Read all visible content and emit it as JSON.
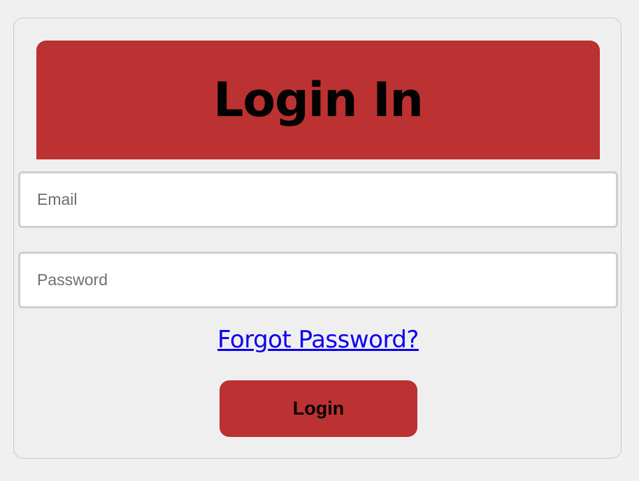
{
  "header": {
    "title": "Login In"
  },
  "form": {
    "email_placeholder": "Email",
    "email_value": "",
    "password_placeholder": "Password",
    "password_value": "",
    "forgot_password_label": "Forgot Password?",
    "login_label": "Login"
  },
  "colors": {
    "accent": "#bc3131",
    "link": "#0b00ee",
    "background": "#f0eff0"
  }
}
